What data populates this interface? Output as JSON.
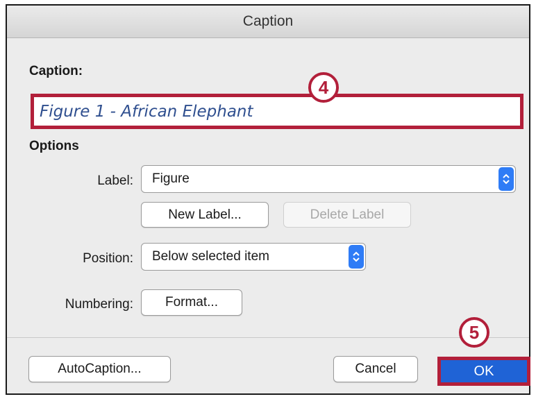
{
  "dialog": {
    "title": "Caption",
    "caption_label": "Caption:",
    "caption_value": "Figure 1 - African Elephant",
    "options_heading": "Options",
    "label_label": "Label:",
    "label_value": "Figure",
    "new_label_button": "New Label...",
    "delete_label_button": "Delete Label",
    "position_label": "Position:",
    "position_value": "Below selected item",
    "numbering_label": "Numbering:",
    "format_button": "Format...",
    "autocaption_button": "AutoCaption...",
    "cancel_button": "Cancel",
    "ok_button": "OK"
  },
  "callouts": {
    "step_4": "4",
    "step_5": "5"
  },
  "colors": {
    "highlight": "#b21f3a",
    "accent": "#2f7cf6",
    "ok_blue": "#1f63d6"
  }
}
